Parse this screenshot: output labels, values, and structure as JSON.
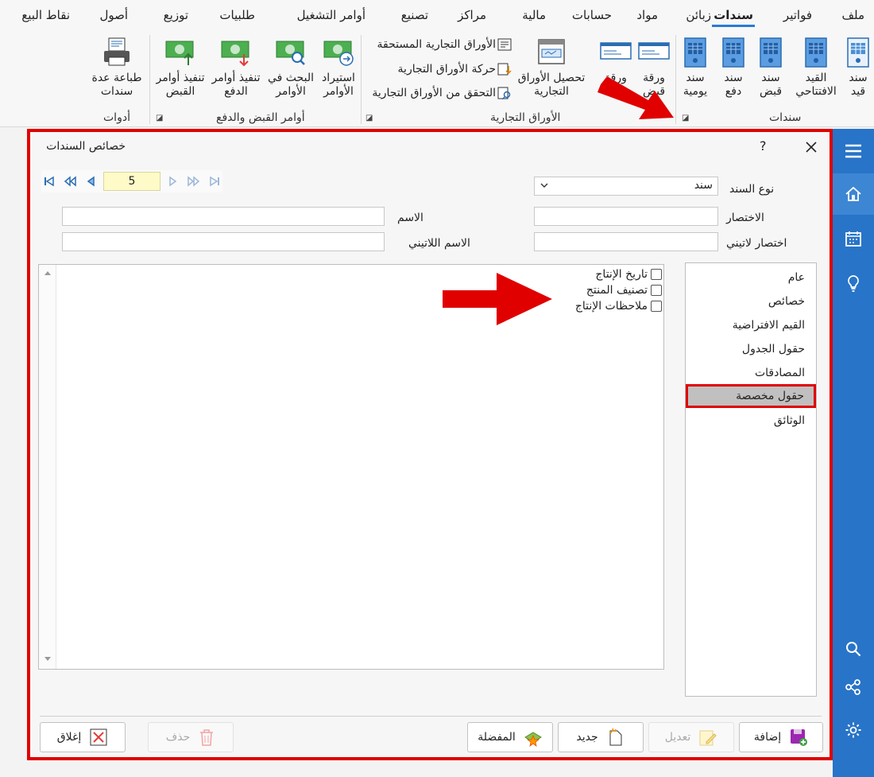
{
  "ribbon": {
    "tabs": [
      "ملف",
      "فواتير",
      "سندات",
      "زبائن",
      "مواد",
      "حسابات",
      "مالية",
      "مراكز",
      "تصنيع",
      "أوامر التشغيل",
      "طلبيات",
      "توزيع",
      "أصول",
      "نقاط البيع"
    ],
    "active_tab": "سندات",
    "groups": {
      "vouchers": "سندات",
      "commercial_papers": "الأوراق التجارية",
      "payment_orders": "أوامر القبض والدفع",
      "tools": "أدوات"
    },
    "buttons": {
      "voucher_entry": "سند قيد",
      "opening_entry": "القيد الافتتاحي",
      "receipt_voucher": "سند قبض",
      "payment_voucher": "سند دفع",
      "daily_voucher": "سند يومية",
      "paper_1": "ورقة قبض",
      "paper_2": "ورقة",
      "collect_papers": "تحصيل الأوراق التجارية",
      "due_papers": "الأوراق التجارية المستحقة",
      "papers_movement": "حركة الأوراق التجارية",
      "verify_papers": "التحقق من الأوراق التجارية",
      "import_orders": "استيراد الأوامر",
      "search_orders": "البحث في الأوامر",
      "exec_payment": "تنفيذ أوامر الدفع",
      "exec_receipt": "تنفيذ أوامر القبض",
      "print_multiple": "طباعة عدة سندات"
    }
  },
  "dialog": {
    "title": "خصائص السندات",
    "help": "?",
    "page_number": "5",
    "voucher_type_label": "نوع السند",
    "voucher_type_value": "سند",
    "abbrev_label": "الاختصار",
    "name_label": "الاسم",
    "latin_abbrev_label": "اختصار لاتيني",
    "latin_name_label": "الاسم اللاتيني",
    "custom_fields": [
      "تاريخ الإنتاج",
      "تصنيف المنتج",
      "ملاحظات الإنتاج"
    ],
    "categories": [
      "عام",
      "خصائص",
      "القيم الافتراضية",
      "حقول الجدول",
      "المصادقات",
      "حقول مخصصة",
      "الوثائق"
    ],
    "selected_category": "حقول مخصصة",
    "footer": {
      "add": "إضافة",
      "edit": "تعديل",
      "new": "جديد",
      "favorites": "المفضلة",
      "delete": "حذف",
      "close": "إغلاق"
    }
  },
  "colors": {
    "accent_blue": "#2874c8",
    "highlight_red": "#e00000",
    "page_field_yellow": "#fffbc8"
  }
}
